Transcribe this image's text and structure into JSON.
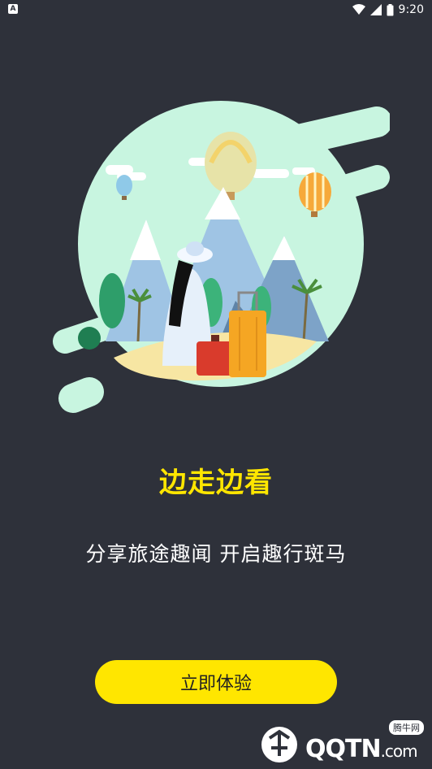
{
  "status_bar": {
    "time": "9:20",
    "left_icon": "A",
    "icons": [
      "wifi-icon",
      "signal-icon",
      "battery-icon"
    ]
  },
  "illustration": {
    "icon": "travel-illustration-icon"
  },
  "main": {
    "headline": "边走边看",
    "subtitle": "分享旅途趣闻 开启趣行斑马",
    "cta_label": "立即体验"
  },
  "watermark": {
    "brand": "QQTN",
    "suffix": ".com",
    "badge": "腾牛网"
  },
  "colors": {
    "background": "#2e313a",
    "accent": "#ffe600",
    "circle": "#c8f5e0"
  }
}
